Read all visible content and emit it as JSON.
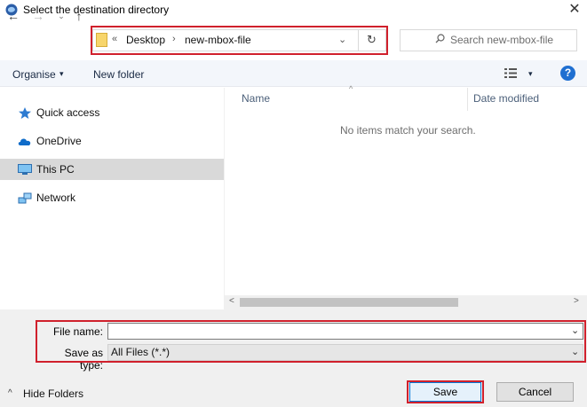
{
  "window": {
    "title": "Select the destination directory",
    "close_glyph": "✕"
  },
  "nav": {
    "back_glyph": "←",
    "forward_glyph": "→",
    "recent_glyph": "⌄",
    "up_glyph": "↑"
  },
  "address": {
    "overflow_glyph": "«",
    "separator_glyph": "›",
    "crumbs": [
      "Desktop",
      "new-mbox-file"
    ],
    "dropdown_glyph": "⌄",
    "refresh_glyph": "↻"
  },
  "search": {
    "placeholder": "Search new-mbox-file"
  },
  "toolbar": {
    "organise_label": "Organise",
    "caret_glyph": "▾",
    "new_folder_label": "New folder",
    "help_glyph": "?"
  },
  "sidebar": {
    "items": [
      {
        "label": "Quick access",
        "icon": "star-icon"
      },
      {
        "label": "OneDrive",
        "icon": "cloud-icon"
      },
      {
        "label": "This PC",
        "icon": "computer-icon",
        "selected": true
      },
      {
        "label": "Network",
        "icon": "network-icon"
      }
    ]
  },
  "file_list": {
    "columns": [
      "Name",
      "Date modified"
    ],
    "sort_glyph": "^",
    "empty_message": "No items match your search."
  },
  "scrollbar": {
    "left_glyph": "<",
    "right_glyph": ">"
  },
  "form": {
    "file_name_label": "File name:",
    "file_name_value": "",
    "save_as_type_label": "Save as type:",
    "save_as_type_value": "All Files (*.*)",
    "dropdown_glyph": "⌄"
  },
  "footer": {
    "hide_folders_glyph": "^",
    "hide_folders_label": "Hide Folders",
    "save_label": "Save",
    "cancel_label": "Cancel"
  },
  "colors": {
    "highlight_border": "#d0202c",
    "toolbar_bg": "#f3f6fb",
    "selected_item_bg": "#d9d9d9",
    "help_blue": "#1f6fd1"
  }
}
